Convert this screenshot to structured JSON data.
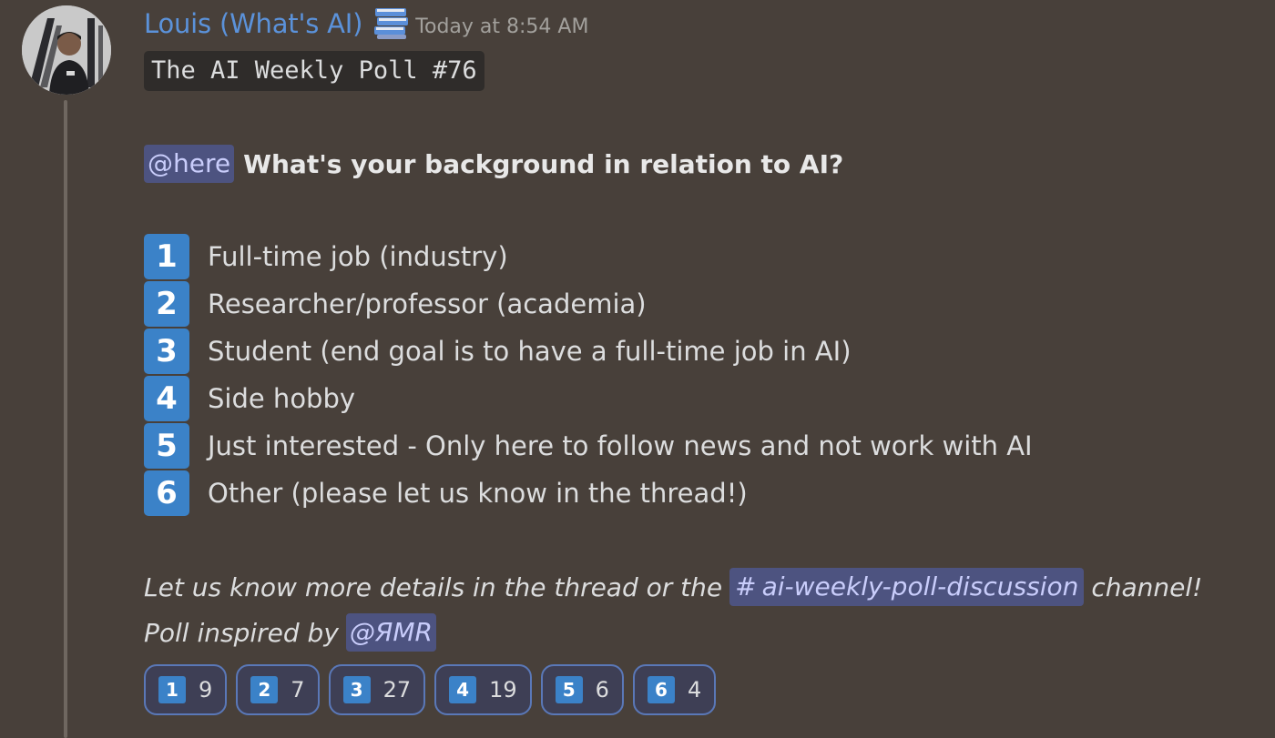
{
  "message": {
    "author": "Louis (What's AI)",
    "role_icon": "books-icon",
    "timestamp": "Today at 8:54 AM",
    "code_title": "The AI Weekly Poll #76",
    "mention": "@here",
    "question": "What's your background in relation to AI?",
    "options": [
      {
        "number": "1",
        "label": "Full-time job (industry)"
      },
      {
        "number": "2",
        "label": "Researcher/professor (academia)"
      },
      {
        "number": "3",
        "label": "Student (end goal is to have a full-time job in AI)"
      },
      {
        "number": "4",
        "label": "Side hobby"
      },
      {
        "number": "5",
        "label": "Just interested - Only here to follow news and not work with AI"
      },
      {
        "number": "6",
        "label": "Other (please let us know in the thread!)"
      }
    ],
    "footer_prefix": "Let us know more details in the thread or the",
    "channel_hash": "#",
    "channel_name": "ai-weekly-poll-discussion",
    "footer_suffix": "channel!",
    "inspired_prefix": "Poll inspired by",
    "inspired_mention": "@ЯMR"
  },
  "reactions": [
    {
      "emoji": "1",
      "count": "9"
    },
    {
      "emoji": "2",
      "count": "7"
    },
    {
      "emoji": "3",
      "count": "27"
    },
    {
      "emoji": "4",
      "count": "19"
    },
    {
      "emoji": "5",
      "count": "6"
    },
    {
      "emoji": "6",
      "count": "4"
    }
  ],
  "colors": {
    "background": "#48403a",
    "author": "#5b92da",
    "number_box": "#3b82c8",
    "mention_bg": "#4d5380",
    "reaction_border": "#5a78b8"
  }
}
